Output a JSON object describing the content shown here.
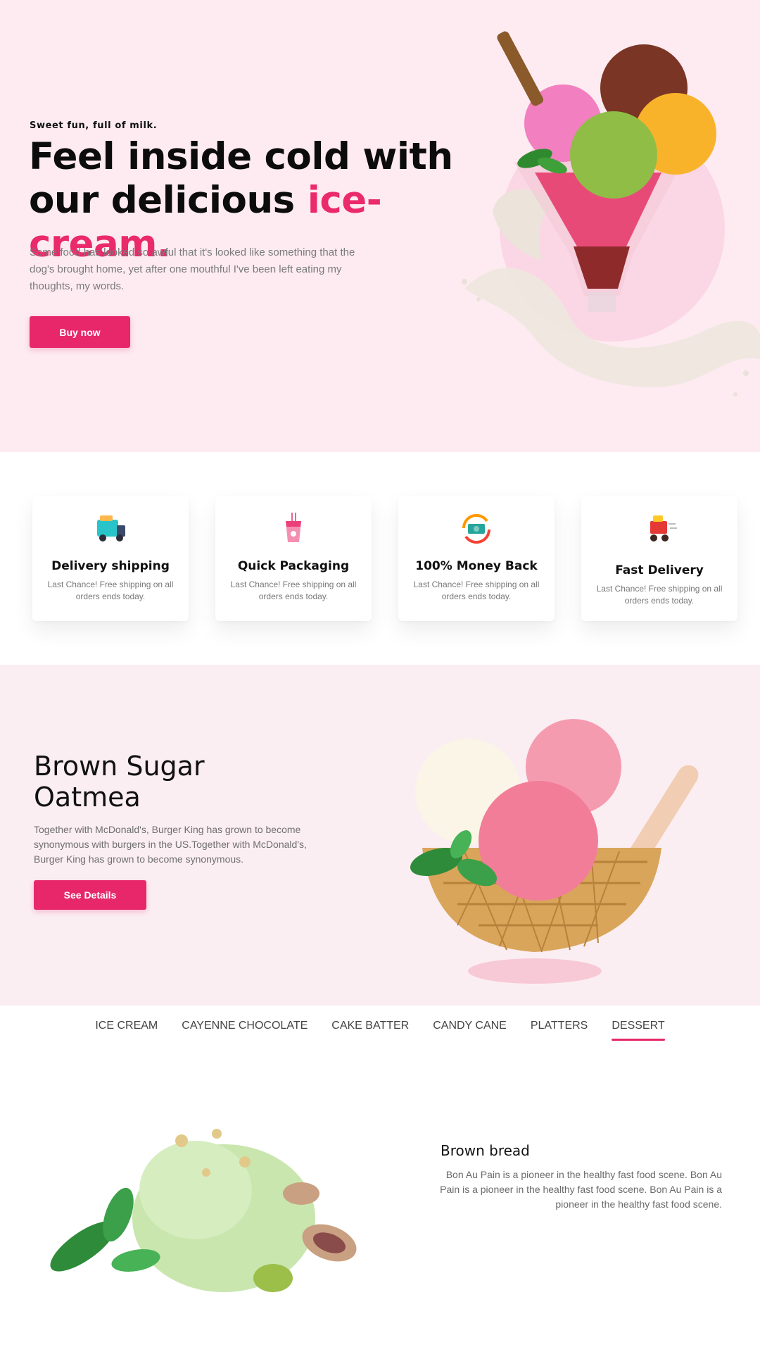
{
  "hero": {
    "kicker": "Sweet fun, full of milk.",
    "title_line1": "Feel inside cold with",
    "title_line2_prefix": "our delicious ",
    "title_accent": "ice-cream.",
    "description": "Some food has looked so awful that it's looked like something that the dog's brought home, yet after one mouthful I've been left eating my thoughts, my words.",
    "cta_label": "Buy now",
    "image_icon": "ice-cream-sundae-splash-image"
  },
  "features": [
    {
      "title": "Delivery shipping",
      "description": "Last Chance! Free shipping on all orders ends today.",
      "icon": "delivery-truck-icon"
    },
    {
      "title": "Quick Packaging",
      "description": "Last Chance! Free shipping on all orders ends today.",
      "icon": "drink-cup-icon"
    },
    {
      "title": "100% Money Back",
      "description": "Last Chance! Free shipping on all orders ends today.",
      "icon": "money-refresh-icon"
    },
    {
      "title": "Fast Delivery",
      "description": "Last Chance! Free shipping on all orders ends today.",
      "icon": "delivery-cart-icon"
    }
  ],
  "promo": {
    "title_line1": "Brown Sugar",
    "title_line2": "Oatmea",
    "description": "Together with McDonald's, Burger King has grown to become synonymous with burgers in the US.Together with McDonald's, Burger King has grown to become synonymous.",
    "cta_label": "See Details",
    "image_icon": "ice-cream-waffle-bowl-image"
  },
  "tabs": [
    {
      "label": "ICE CREAM",
      "active": false
    },
    {
      "label": "CAYENNE CHOCOLATE",
      "active": false
    },
    {
      "label": "CAKE BATTER",
      "active": false
    },
    {
      "label": "CANDY CANE",
      "active": false
    },
    {
      "label": "PLATTERS",
      "active": false
    },
    {
      "label": "DESSERT",
      "active": true
    }
  ],
  "product": {
    "title": "Brown bread",
    "description": "Bon Au Pain is a pioneer in the healthy fast food scene. Bon Au Pain is a pioneer in the healthy fast food scene. Bon Au Pain is a pioneer in the healthy fast food scene.",
    "image_icon": "pistachio-ice-cream-image"
  },
  "colors": {
    "accent": "#e7276a",
    "hero_bg": "#fdebf1",
    "promo_bg": "#fbeef2"
  }
}
